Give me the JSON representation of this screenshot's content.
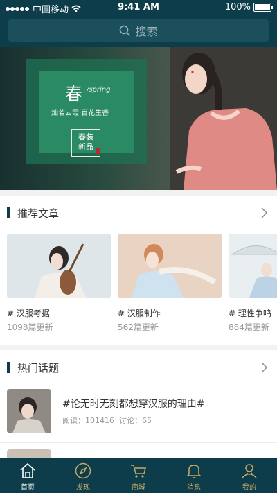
{
  "status": {
    "carrier": "中国移动",
    "time": "9:41 AM",
    "battery": "100%"
  },
  "search": {
    "placeholder": "搜索"
  },
  "banner": {
    "season": "春",
    "season_en": "/spring",
    "tagline": "灿若云霞·百花生香",
    "tag_line1": "春装",
    "tag_line2": "新品"
  },
  "articles": {
    "title": "推荐文章",
    "items": [
      {
        "name": "#  汉服考据",
        "count": "1098篇更新"
      },
      {
        "name": "#  汉服制作",
        "count": "562篇更新"
      },
      {
        "name": "#  理性争鸣",
        "count": "884篇更新"
      }
    ]
  },
  "topics": {
    "title": "热门话题",
    "items": [
      {
        "title": "#论无时无刻都想穿汉服的理由#",
        "reads_label": "阅读：",
        "reads": "101416",
        "comments_label": "讨论：",
        "comments": "65"
      }
    ]
  },
  "tabs": [
    {
      "label": "首页",
      "icon": "home-icon"
    },
    {
      "label": "发现",
      "icon": "compass-icon"
    },
    {
      "label": "商城",
      "icon": "cart-icon"
    },
    {
      "label": "消息",
      "icon": "bell-icon"
    },
    {
      "label": "我的",
      "icon": "profile-icon"
    }
  ],
  "colors": {
    "theme": "#0d3d4a",
    "tab_inactive": "#c9a86a",
    "banner_green": "#2a8a64"
  }
}
